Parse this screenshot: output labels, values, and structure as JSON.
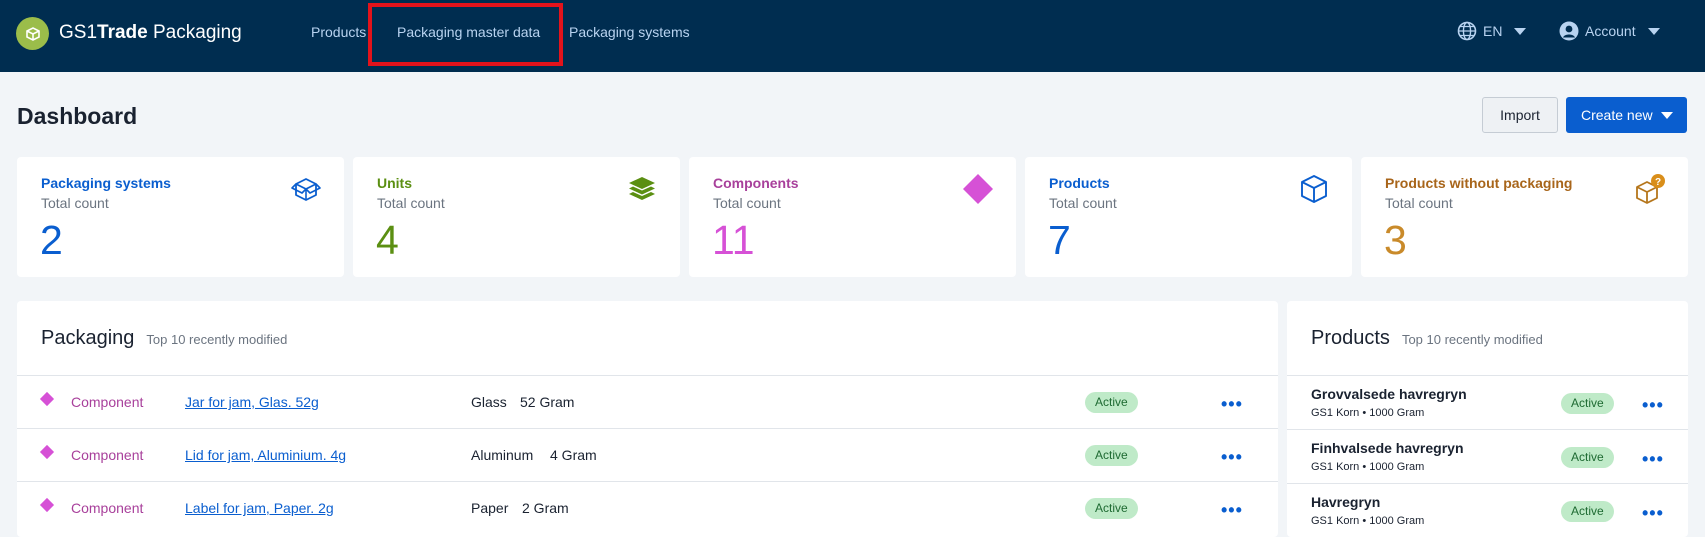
{
  "app": {
    "logo_prefix": "GS1",
    "logo_bold": "Trade",
    "logo_suffix": " Packaging"
  },
  "nav": {
    "items": [
      {
        "label": "Products"
      },
      {
        "label": "Packaging master data"
      },
      {
        "label": "Packaging systems"
      }
    ],
    "highlighted": "Packaging master data",
    "language": "EN",
    "account": "Account"
  },
  "page": {
    "title": "Dashboard",
    "import_label": "Import",
    "create_label": "Create new"
  },
  "stats": [
    {
      "title": "Packaging systems",
      "sub": "Total count",
      "count": "2",
      "color": "#0a5ecf",
      "icon": "box-open-icon"
    },
    {
      "title": "Units",
      "sub": "Total count",
      "count": "4",
      "color": "#5b8f12",
      "icon": "layers-icon"
    },
    {
      "title": "Components",
      "sub": "Total count",
      "count": "11",
      "color": "#c84bc4",
      "icon": "diamond-icon"
    },
    {
      "title": "Products",
      "sub": "Total count",
      "count": "7",
      "color": "#0a5ecf",
      "icon": "cube-icon"
    },
    {
      "title": "Products without packaging",
      "sub": "Total count",
      "count": "3",
      "color": "#b5761c",
      "icon": "cube-question-icon"
    }
  ],
  "packaging": {
    "title": "Packaging",
    "subtitle": "Top 10 recently modified",
    "rows": [
      {
        "type": "Component",
        "name": "Jar for jam, Glas. 52g",
        "material": "Glass",
        "weight": "52 Gram",
        "status": "Active"
      },
      {
        "type": "Component",
        "name": "Lid for jam, Aluminium. 4g",
        "material": "Aluminum",
        "weight": "4 Gram",
        "status": "Active"
      },
      {
        "type": "Component",
        "name": "Label for jam, Paper. 2g",
        "material": "Paper",
        "weight": "2 Gram",
        "status": "Active"
      }
    ]
  },
  "products": {
    "title": "Products",
    "subtitle": "Top 10 recently modified",
    "rows": [
      {
        "name": "Grovvalsede havregryn",
        "meta": "GS1 Korn • 1000 Gram",
        "status": "Active"
      },
      {
        "name": "Finhvalsede havregryn",
        "meta": "GS1 Korn • 1000 Gram",
        "status": "Active"
      },
      {
        "name": "Havregryn",
        "meta": "GS1 Korn • 1000 Gram",
        "status": "Active"
      }
    ]
  },
  "icons": {
    "more": "more-icon",
    "globe": "globe-icon",
    "user": "user-icon"
  }
}
